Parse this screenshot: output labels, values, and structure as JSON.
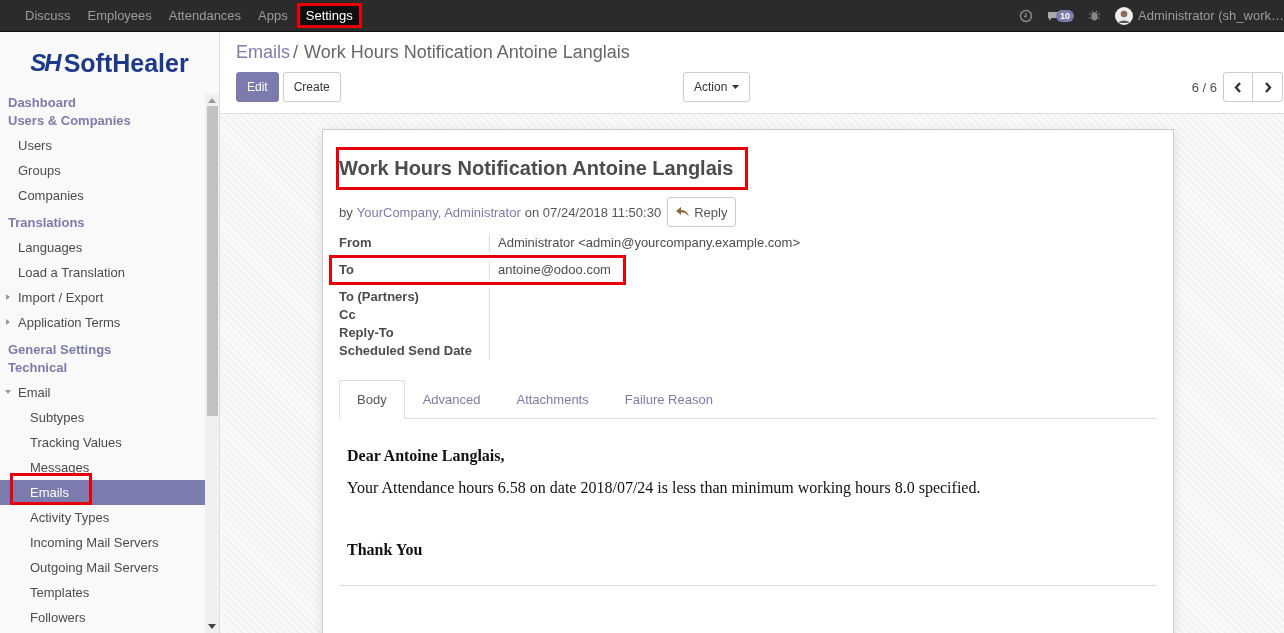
{
  "topbar": {
    "menus": [
      {
        "label": "Discuss",
        "highlighted": false
      },
      {
        "label": "Employees",
        "highlighted": false
      },
      {
        "label": "Attendances",
        "highlighted": false
      },
      {
        "label": "Apps",
        "highlighted": false
      },
      {
        "label": "Settings",
        "highlighted": true
      }
    ],
    "chat_badge": "10",
    "user": "Administrator (sh_work…"
  },
  "sidebar": {
    "logo_mark": "SH",
    "logo_text": "SoftHealer",
    "sections": [
      {
        "title": "Dashboard"
      },
      {
        "title": "Users & Companies",
        "items": [
          {
            "label": "Users",
            "selected": false,
            "highlighted": false
          },
          {
            "label": "Groups",
            "selected": false,
            "highlighted": false
          },
          {
            "label": "Companies",
            "selected": false,
            "highlighted": false
          }
        ]
      },
      {
        "title": "Translations",
        "items": [
          {
            "label": "Languages",
            "selected": false,
            "highlighted": false
          },
          {
            "label": "Load a Translation",
            "selected": false,
            "highlighted": false
          },
          {
            "label": "Import / Export",
            "selected": false,
            "highlighted": false,
            "expanded": false
          },
          {
            "label": "Application Terms",
            "selected": false,
            "highlighted": false,
            "expanded": false
          }
        ]
      },
      {
        "title": "General Settings"
      },
      {
        "title": "Technical",
        "items": [
          {
            "label": "Email",
            "selected": false,
            "highlighted": false,
            "expanded": true,
            "children": [
              {
                "label": "Subtypes",
                "selected": false,
                "highlighted": false
              },
              {
                "label": "Tracking Values",
                "selected": false,
                "highlighted": false
              },
              {
                "label": "Messages",
                "selected": false,
                "highlighted": false
              },
              {
                "label": "Emails",
                "selected": true,
                "highlighted": true
              },
              {
                "label": "Activity Types",
                "selected": false,
                "highlighted": false
              },
              {
                "label": "Incoming Mail Servers",
                "selected": false,
                "highlighted": false
              },
              {
                "label": "Outgoing Mail Servers",
                "selected": false,
                "highlighted": false
              },
              {
                "label": "Templates",
                "selected": false,
                "highlighted": false
              },
              {
                "label": "Followers",
                "selected": false,
                "highlighted": false
              }
            ]
          }
        ]
      }
    ]
  },
  "breadcrumb": [
    "Emails",
    "Work Hours Notification Antoine Langlais"
  ],
  "breadcrumb_separator": "/",
  "buttons": {
    "edit": "Edit",
    "create": "Create",
    "action": "Action"
  },
  "pager": "6 / 6",
  "email": {
    "subject": "Work Hours Notification Antoine Langlais",
    "subject_highlighted": true,
    "by": "by",
    "author": "YourCompany, Administrator",
    "date": "on 07/24/2018 11:50:30",
    "reply": "Reply",
    "fields": [
      {
        "label": "From",
        "value": "Administrator <admin@yourcompany.example.com>",
        "highlighted": false
      },
      {
        "label": "To",
        "value": "antoine@odoo.com",
        "highlighted": true
      },
      {
        "label": "To (Partners)",
        "highlighted": false
      },
      {
        "label": "Cc",
        "highlighted": false
      },
      {
        "label": "Reply-To",
        "highlighted": false
      },
      {
        "label": "Scheduled Send Date",
        "highlighted": false
      }
    ],
    "tabs": [
      {
        "label": "Body",
        "selected": true
      },
      {
        "label": "Advanced",
        "selected": false
      },
      {
        "label": "Attachments",
        "selected": false
      },
      {
        "label": "Failure Reason",
        "selected": false
      }
    ],
    "body": {
      "greeting": "Dear Antoine Langlais,",
      "text": "Your Attendance hours 6.58 on date 2018/07/24 is less than minimum working hours 8.0 specified.",
      "closing": "Thank You"
    }
  }
}
